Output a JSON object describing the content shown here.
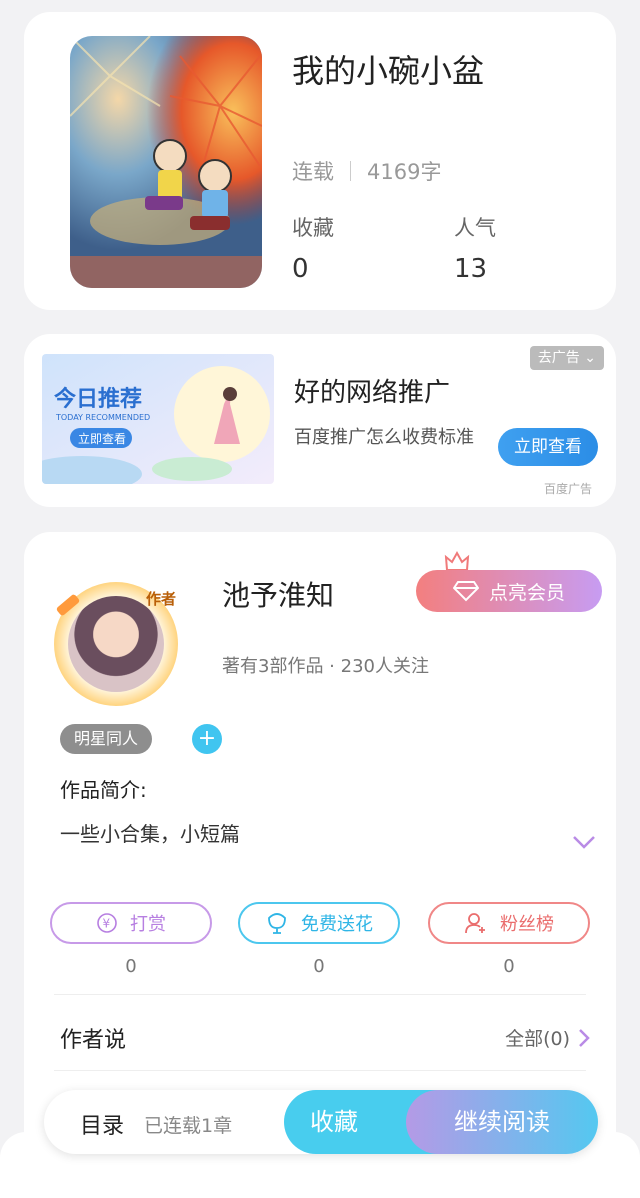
{
  "book": {
    "title": "我的小碗小盆",
    "status": "连载",
    "word_count": "4169字",
    "stats": [
      {
        "label": "收藏",
        "value": "0"
      },
      {
        "label": "人气",
        "value": "13"
      }
    ]
  },
  "ad": {
    "banner_title": "今日推荐",
    "banner_subtitle": "TODAY RECOMMENDED",
    "banner_button": "立即查看",
    "title": "好的网络推广",
    "description": "百度推广怎么收费标准",
    "tag": "去广告",
    "button_label": "立即查看",
    "source": "百度广告"
  },
  "author": {
    "badge": "作者",
    "name": "池予淮知",
    "meta": "著有3部作品 · 230人关注",
    "vip_label": "点亮会员",
    "tag": "明星同人",
    "add_symbol": "+",
    "intro_heading": "作品简介:",
    "intro_text": "一些小合集，小短篇",
    "actions": [
      {
        "label": "打赏",
        "count": "0",
        "icon": "yen-coin-icon"
      },
      {
        "label": "免费送花",
        "count": "0",
        "icon": "flower-icon"
      },
      {
        "label": "粉丝榜",
        "count": "0",
        "icon": "fans-icon"
      }
    ],
    "says_heading": "作者说",
    "all_link": "全部(0)"
  },
  "bottom_bar": {
    "toc_label": "目录",
    "chapters": "已连载1章",
    "favorite_label": "收藏",
    "read_label": "继续阅读"
  },
  "colors": {
    "accent_blue": "#48cdee",
    "vip_gradient_start": "#f37f7f",
    "vip_gradient_end": "#c79cf2"
  }
}
